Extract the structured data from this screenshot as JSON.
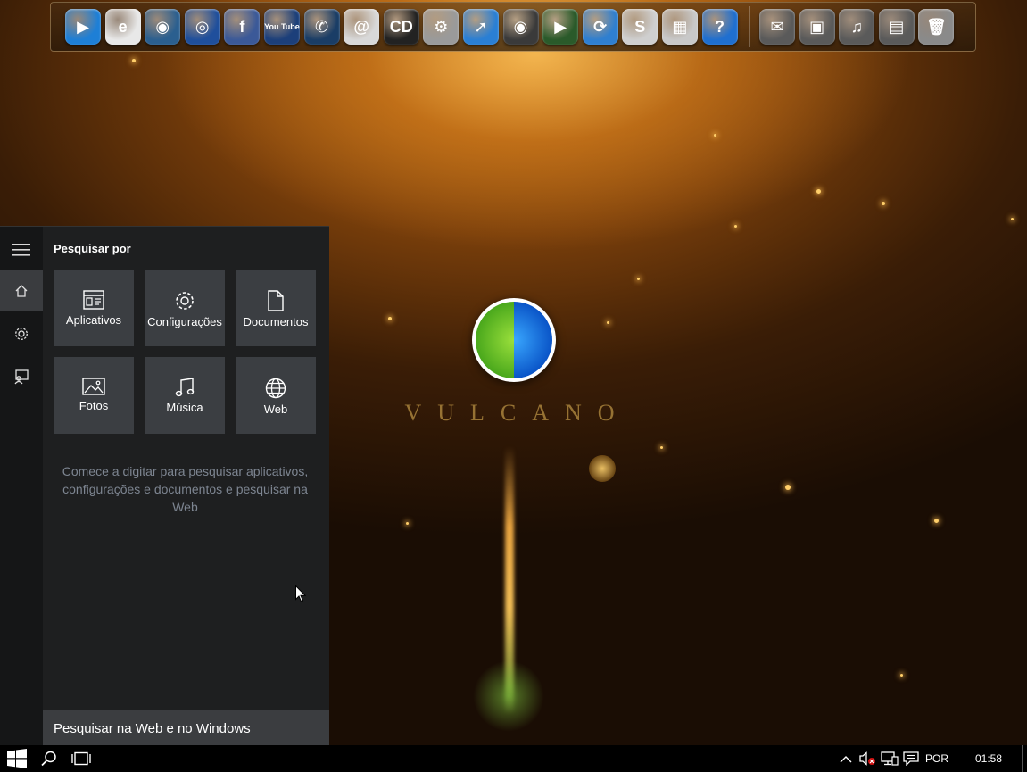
{
  "desktop": {
    "logo_text": "VULCANO"
  },
  "dock": {
    "icons": [
      {
        "name": "media-player",
        "glyph": "▶",
        "color": "#1e7fd6"
      },
      {
        "name": "internet-explorer",
        "glyph": "e",
        "color": "#e8e8e8"
      },
      {
        "name": "chrome-orb",
        "glyph": "◉",
        "color": "#2b5f8f"
      },
      {
        "name": "firefox",
        "glyph": "◎",
        "color": "#1f4f9c"
      },
      {
        "name": "facebook",
        "glyph": "f",
        "color": "#3b5998"
      },
      {
        "name": "youtube",
        "glyph": "You Tube",
        "color": "#1c3f7a"
      },
      {
        "name": "whatsapp",
        "glyph": "✆",
        "color": "#1a3d66"
      },
      {
        "name": "email",
        "glyph": "@",
        "color": "#d8d8d8"
      },
      {
        "name": "cd-burner",
        "glyph": "CD",
        "color": "#222222"
      },
      {
        "name": "film-reels",
        "glyph": "⚙",
        "color": "#9a9a9a"
      },
      {
        "name": "send-arrow",
        "glyph": "➚",
        "color": "#2a7fd4"
      },
      {
        "name": "camera-lens",
        "glyph": "◉",
        "color": "#3a3a3a"
      },
      {
        "name": "video-clapper",
        "glyph": "▶",
        "color": "#2a5a2a"
      },
      {
        "name": "update-globe",
        "glyph": "⟳",
        "color": "#2f7fd0"
      },
      {
        "name": "skype",
        "glyph": "S",
        "color": "#cfcfcf"
      },
      {
        "name": "firewall",
        "glyph": "▦",
        "color": "#c8c8c8"
      },
      {
        "name": "help-book",
        "glyph": "?",
        "color": "#1f6fd0"
      },
      {
        "name": "folder-mail",
        "glyph": "✉",
        "color": "#5a5a5a"
      },
      {
        "name": "folder-pictures",
        "glyph": "▣",
        "color": "#5a5a5a"
      },
      {
        "name": "folder-music",
        "glyph": "♫",
        "color": "#5a5a5a"
      },
      {
        "name": "folder-videos",
        "glyph": "▤",
        "color": "#5a5a5a"
      },
      {
        "name": "recycle-bin",
        "glyph": "🗑",
        "color": "#8a8a8a"
      }
    ]
  },
  "search_panel": {
    "header": "Pesquisar por",
    "tiles": [
      {
        "label": "Aplicativos",
        "icon": "apps-icon"
      },
      {
        "label": "Configurações",
        "icon": "settings-icon"
      },
      {
        "label": "Documentos",
        "icon": "document-icon"
      },
      {
        "label": "Fotos",
        "icon": "photo-icon"
      },
      {
        "label": "Música",
        "icon": "music-icon"
      },
      {
        "label": "Web",
        "icon": "globe-icon"
      }
    ],
    "hint": "Comece a digitar para pesquisar aplicativos, configurações e documentos e pesquisar na Web",
    "search_placeholder": "Pesquisar na Web e no Windows"
  },
  "taskbar": {
    "language": "POR",
    "time": "01:58"
  }
}
